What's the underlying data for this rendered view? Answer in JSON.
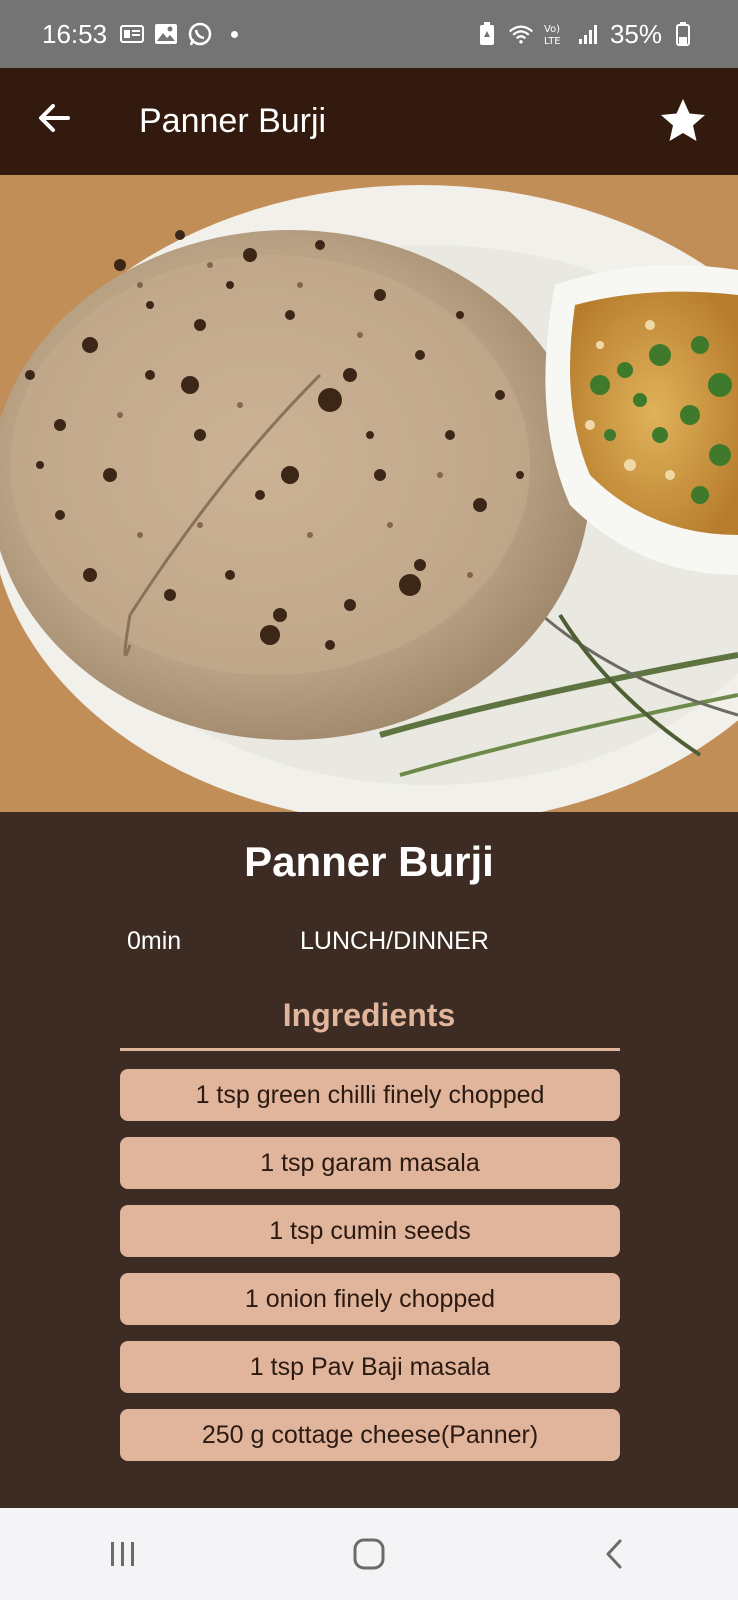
{
  "status_bar": {
    "time": "16:53",
    "battery": "35%"
  },
  "app_bar": {
    "title": "Panner Burji",
    "back_icon": "arrow-left-icon",
    "favorite_icon": "star-icon"
  },
  "recipe": {
    "title": "Panner Burji",
    "time": "0min",
    "category": "LUNCH/DINNER",
    "ingredients_heading": "Ingredients",
    "ingredients": [
      "1 tsp green chilli finely chopped",
      "1 tsp garam masala",
      "1 tsp cumin seeds",
      "1 onion finely chopped",
      "1 tsp Pav Baji masala",
      "250 g cottage cheese(Panner)"
    ]
  },
  "colors": {
    "app_bar": "#331a0e",
    "background": "#3d2c24",
    "accent": "#e0b59c"
  }
}
